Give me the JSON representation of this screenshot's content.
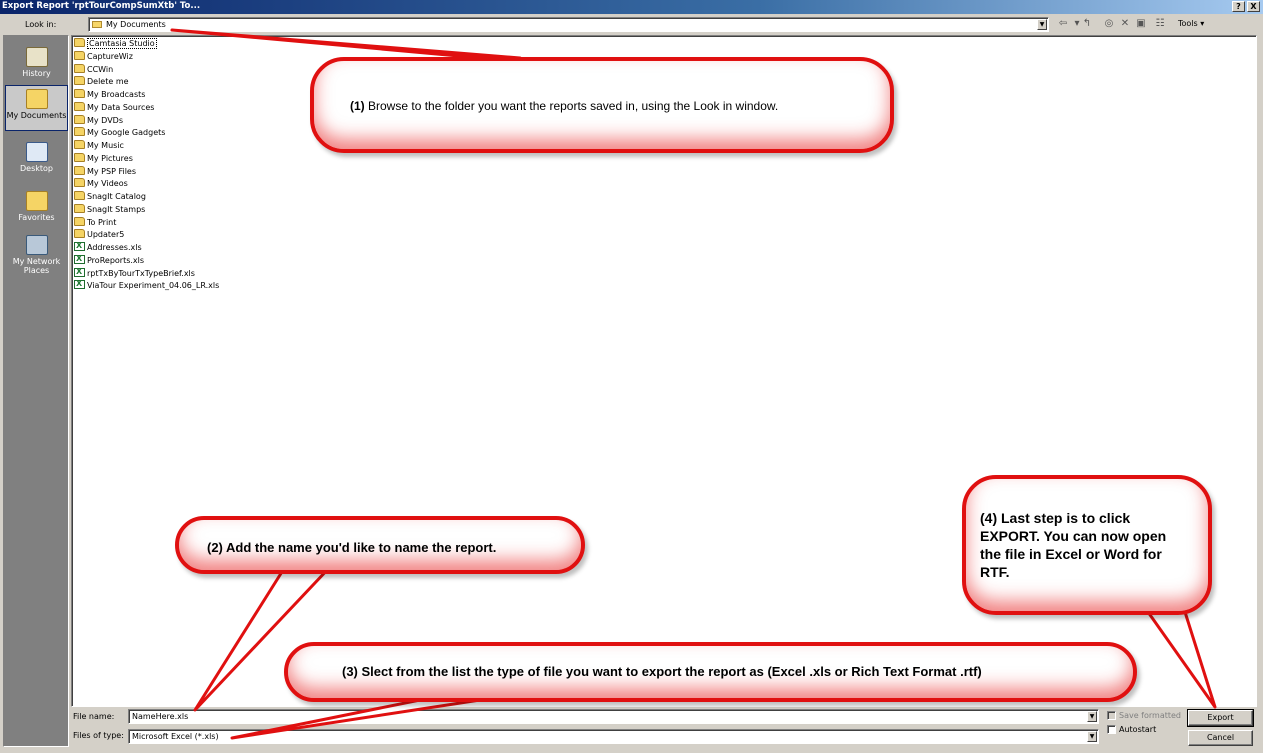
{
  "window": {
    "title": "Export Report 'rptTourCompSumXtb' To...",
    "help_btn": "?",
    "close_btn": "X"
  },
  "lookin": {
    "label": "Look in:",
    "value": "My Documents",
    "tools_label": "Tools ▾"
  },
  "places": [
    {
      "label": "History",
      "icon": "history-icon"
    },
    {
      "label": "My Documents",
      "icon": "my-documents-icon",
      "selected": true
    },
    {
      "label": "Desktop",
      "icon": "desktop-icon"
    },
    {
      "label": "Favorites",
      "icon": "favorites-icon"
    },
    {
      "label": "My Network Places",
      "icon": "network-icon"
    }
  ],
  "files": [
    {
      "name": "Camtasia Studio",
      "type": "folder"
    },
    {
      "name": "CaptureWiz",
      "type": "folder"
    },
    {
      "name": "CCWin",
      "type": "folder"
    },
    {
      "name": "Delete me",
      "type": "folder"
    },
    {
      "name": "My Broadcasts",
      "type": "folder"
    },
    {
      "name": "My Data Sources",
      "type": "folder"
    },
    {
      "name": "My DVDs",
      "type": "folder"
    },
    {
      "name": "My Google Gadgets",
      "type": "folder"
    },
    {
      "name": "My Music",
      "type": "folder"
    },
    {
      "name": "My Pictures",
      "type": "folder"
    },
    {
      "name": "My PSP Files",
      "type": "folder"
    },
    {
      "name": "My Videos",
      "type": "folder"
    },
    {
      "name": "SnagIt Catalog",
      "type": "folder"
    },
    {
      "name": "SnagIt Stamps",
      "type": "folder"
    },
    {
      "name": "To Print",
      "type": "folder"
    },
    {
      "name": "Updater5",
      "type": "folder"
    },
    {
      "name": "Addresses.xls",
      "type": "xls"
    },
    {
      "name": "ProReports.xls",
      "type": "xls"
    },
    {
      "name": "rptTxByTourTxTypeBrief.xls",
      "type": "xls"
    },
    {
      "name": "ViaTour Experiment_04.06_LR.xls",
      "type": "xls"
    }
  ],
  "bottom": {
    "filename_label": "File name:",
    "filename_value": "NameHere.xls",
    "filetype_label": "Files of type:",
    "filetype_value": "Microsoft Excel (*.xls)",
    "save_formatted": "Save formatted",
    "autostart": "Autostart",
    "export_btn": "Export",
    "cancel_btn": "Cancel"
  },
  "callouts": {
    "c1_num": "(1)",
    "c1_text": " Browse to the folder you want the reports saved in, using the Look in window.",
    "c2": "(2) Add the name you'd like to name the report.",
    "c3": "(3) Slect from the list the type of file you want to export the report as (Excel .xls or Rich Text Format .rtf)",
    "c4": "(4) Last step is to click EXPORT. You can now open the file in Excel or Word for RTF."
  },
  "colors": {
    "callout_border": "#e01010",
    "title_bar": "#0a246a",
    "dialog_face": "#d4d0c8"
  }
}
